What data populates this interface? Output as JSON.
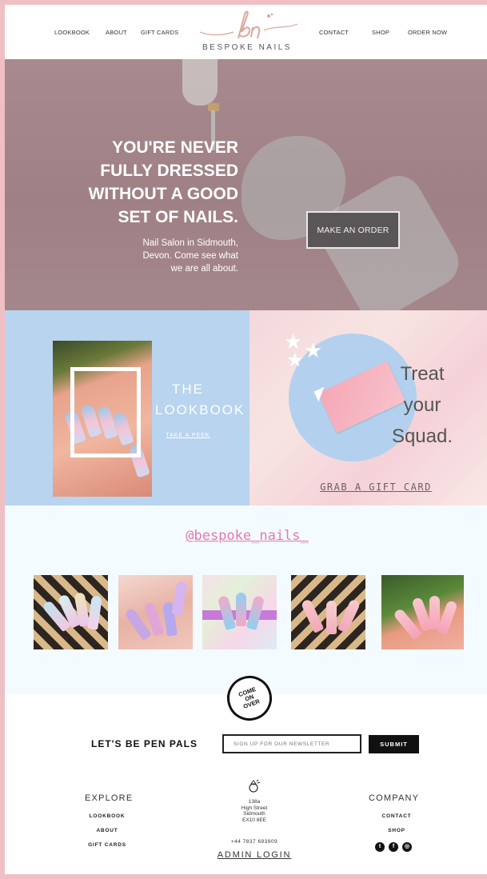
{
  "header": {
    "nav_left": [
      "LOOKBOOK",
      "ABOUT",
      "GIFT CARDS"
    ],
    "nav_right": [
      "CONTACT",
      "SHOP",
      "ORDER NOW"
    ],
    "logo_text": "BESPOKE NAILS"
  },
  "hero": {
    "title_lines": [
      "YOU'RE NEVER",
      "FULLY DRESSED",
      "WITHOUT A GOOD",
      "SET OF NAILS."
    ],
    "subtitle_lines": [
      "Nail Salon in Sidmouth,",
      "Devon. Come see what",
      "we are all about."
    ],
    "button": "MAKE AN ORDER"
  },
  "lookbook": {
    "title_lines": [
      "THE",
      "LOOKBOOK"
    ],
    "link": "TAKE A PEEK"
  },
  "gift": {
    "title_lines": [
      "Treat",
      "your",
      "Squad."
    ],
    "link": "GRAB A GIFT CARD"
  },
  "instagram": {
    "handle": "@bespoke_nails_"
  },
  "newsletter": {
    "badge_lines": [
      "COME",
      "ON",
      "OVER"
    ],
    "label": "LET'S BE PEN PALS",
    "placeholder": "SIGN UP FOR OUR NEWSLETTER",
    "submit": "SUBMIT"
  },
  "footer": {
    "explore_heading": "EXPLORE",
    "explore_links": [
      "LOOKBOOK",
      "ABOUT",
      "GIFT CARDS"
    ],
    "address_lines": [
      "138a",
      "High Street",
      "Sidmouth",
      "EX10 8EE"
    ],
    "phone": "+44 7837 693909",
    "admin": "ADMIN LOGIN",
    "company_heading": "COMPANY",
    "company_links": [
      "CONTACT",
      "SHOP"
    ],
    "social_icons": [
      "twitter-icon",
      "facebook-icon",
      "instagram-icon"
    ]
  },
  "colors": {
    "page_border": "#efbfc4",
    "hero": "#a88a8e",
    "lookbook_blue": "#b8d4ee",
    "gift_pink": "#f4d8dc",
    "handle_pink": "#e07ab0"
  }
}
